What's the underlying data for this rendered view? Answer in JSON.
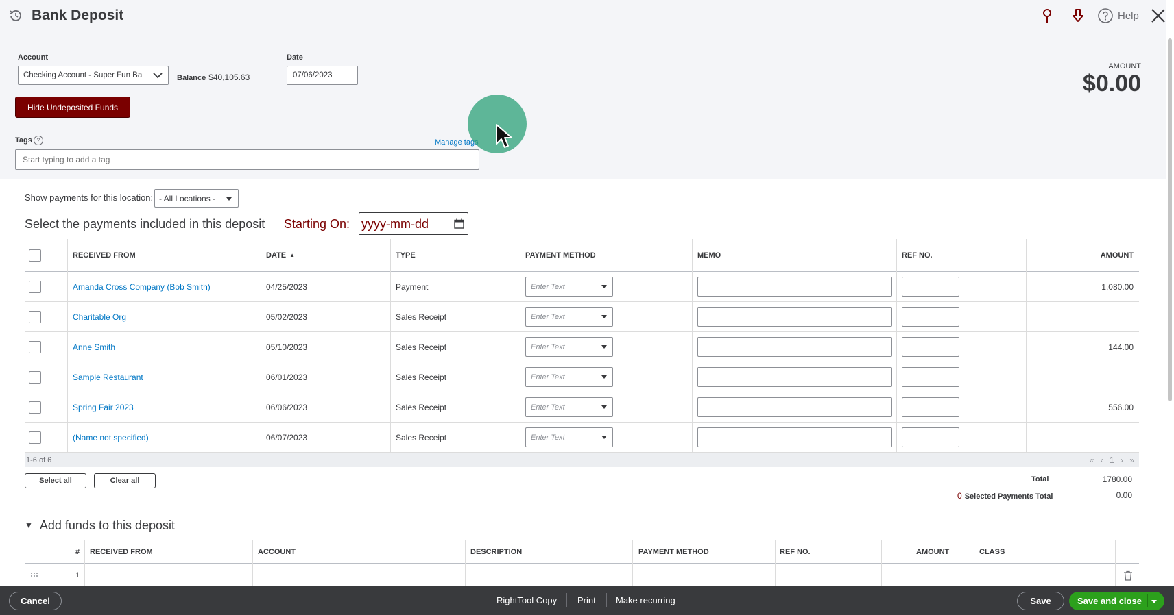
{
  "header": {
    "title": "Bank Deposit",
    "help_label": "Help"
  },
  "form": {
    "account_label": "Account",
    "account_value": "Checking Account - Super Fun Ba",
    "balance_label": "Balance",
    "balance_value": "$40,105.63",
    "date_label": "Date",
    "date_value": "07/06/2023",
    "amount_label": "AMOUNT",
    "amount_value": "$0.00",
    "hide_button": "Hide Undeposited Funds",
    "tags_label": "Tags",
    "manage_tags": "Manage tags",
    "tags_placeholder": "Start typing to add a tag"
  },
  "payments": {
    "location_label": "Show payments for this location:",
    "location_value": "- All Locations -",
    "section_title": "Select the payments included in this deposit",
    "starting_on_label": "Starting On:",
    "starting_on_placeholder": "yyyy-mm-dd",
    "columns": {
      "received_from": "RECEIVED FROM",
      "date": "DATE",
      "type": "TYPE",
      "payment_method": "PAYMENT METHOD",
      "memo": "MEMO",
      "ref_no": "REF NO.",
      "amount": "AMOUNT"
    },
    "payment_method_placeholder": "Enter Text",
    "rows": [
      {
        "received_from": "Amanda Cross Company (Bob Smith)",
        "date": "04/25/2023",
        "type": "Payment",
        "amount": "1,080.00"
      },
      {
        "received_from": "Charitable Org",
        "date": "05/02/2023",
        "type": "Sales Receipt",
        "amount": ""
      },
      {
        "received_from": "Anne Smith",
        "date": "05/10/2023",
        "type": "Sales Receipt",
        "amount": "144.00"
      },
      {
        "received_from": "Sample Restaurant",
        "date": "06/01/2023",
        "type": "Sales Receipt",
        "amount": ""
      },
      {
        "received_from": "Spring Fair 2023",
        "date": "06/06/2023",
        "type": "Sales Receipt",
        "amount": "556.00"
      },
      {
        "received_from": "(Name not specified)",
        "date": "06/07/2023",
        "type": "Sales Receipt",
        "amount": ""
      }
    ],
    "pagination_count": "1-6 of 6",
    "pagination_controls": "« ‹ 1 › »",
    "select_all": "Select all",
    "clear_all": "Clear all",
    "total_label": "Total",
    "total_value": "1780.00",
    "selected_count": "0",
    "selected_label": "Selected Payments Total",
    "selected_value": "0.00"
  },
  "add_funds": {
    "title": "Add funds to this deposit",
    "columns": {
      "num": "#",
      "received_from": "RECEIVED FROM",
      "account": "ACCOUNT",
      "description": "DESCRIPTION",
      "payment_method": "PAYMENT METHOD",
      "ref_no": "REF NO.",
      "amount": "AMOUNT",
      "class": "CLASS"
    },
    "first_row_number": "1"
  },
  "footer": {
    "cancel": "Cancel",
    "righttool": "RightTool Copy",
    "print": "Print",
    "make_recurring": "Make recurring",
    "save": "Save",
    "save_and_close": "Save and close"
  },
  "colors": {
    "accent_red": "#7a0000",
    "link_blue": "#0077c5",
    "save_green": "#2ca01c",
    "footer_bg": "#393a3d"
  }
}
